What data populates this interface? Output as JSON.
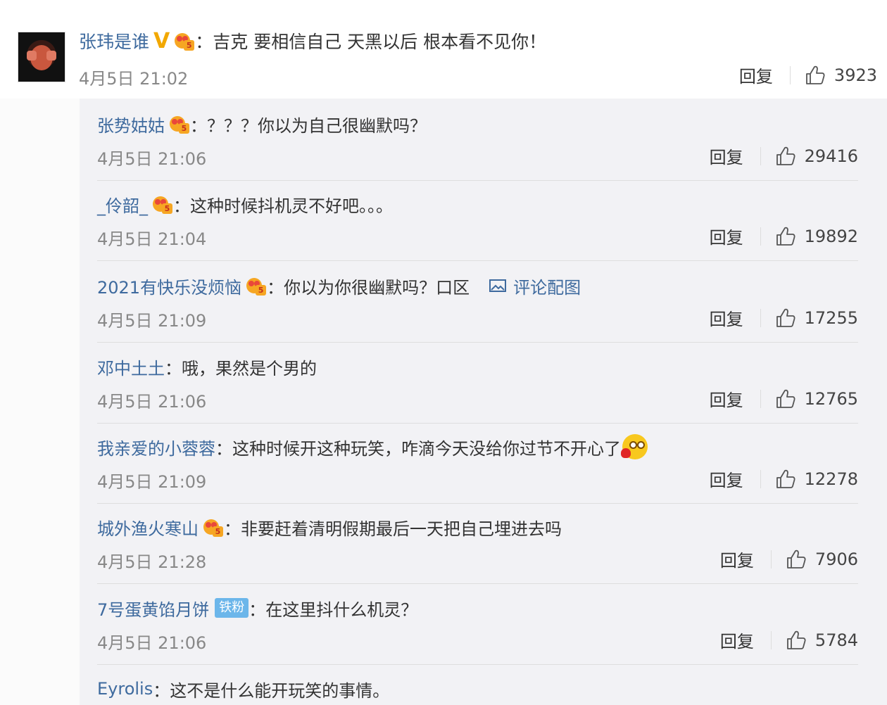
{
  "main_comment": {
    "username": "张玮是谁",
    "verified": "V",
    "colon": "：",
    "text": "吉克 要相信自己 天黑以后 根本看不见你！",
    "time": "4月5日 21:02",
    "reply_label": "回复",
    "likes": "3923"
  },
  "crown_badge_text": "5",
  "replies": [
    {
      "username": "张势姑姑",
      "colon": "：",
      "text": "？？？你以为自己很幽默吗？",
      "time": "4月5日 21:06",
      "reply_label": "回复",
      "likes": "29416"
    },
    {
      "username": "_伶韶_",
      "colon": "：",
      "text": "这种时候抖机灵不好吧。。。",
      "time": "4月5日 21:04",
      "reply_label": "回复",
      "likes": "19892"
    },
    {
      "username": "2021有快乐没烦恼",
      "colon": "：",
      "text": "你以为你很幽默吗？口区",
      "pic_label": "评论配图",
      "time": "4月5日 21:09",
      "reply_label": "回复",
      "likes": "17255"
    },
    {
      "username": "邓中土土",
      "colon": "：",
      "text": "哦，果然是个男的",
      "time": "4月5日 21:06",
      "reply_label": "回复",
      "likes": "12765"
    },
    {
      "username": "我亲爱的小蓉蓉",
      "colon": "：",
      "text": "这种时候开这种玩笑，咋滴今天没给你过节不开心了",
      "time": "4月5日 21:09",
      "reply_label": "回复",
      "likes": "12278"
    },
    {
      "username": "城外渔火寒山",
      "colon": "：",
      "text": "非要赶着清明假期最后一天把自己埋进去吗",
      "time": "4月5日 21:28",
      "reply_label": "回复",
      "likes": "7906"
    },
    {
      "username": "7号蛋黄馅月饼",
      "fan_badge": "铁粉",
      "colon": "：",
      "text": "在这里抖什么机灵？",
      "time": "4月5日 21:06",
      "reply_label": "回复",
      "likes": "5784"
    },
    {
      "username": "Eyrolis",
      "colon": "：",
      "text": "这不是什么能开玩笑的事情。"
    }
  ],
  "colors": {
    "username": "#3e6a9e",
    "text": "#333333",
    "time": "#888888",
    "reply_bg": "#f2f2f5",
    "fan_badge": "#6cb6ea"
  },
  "icons": [
    "thumbs-up-icon",
    "crown-badge-icon",
    "image-icon",
    "smiley-heart-emoji"
  ]
}
